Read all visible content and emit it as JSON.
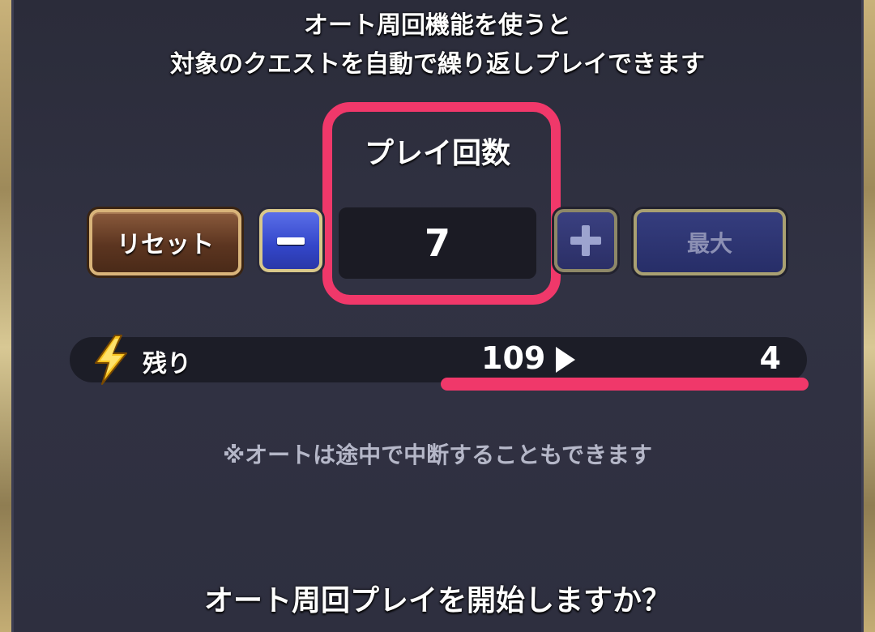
{
  "header": {
    "line1": "オート周回機能を使うと",
    "line2": "対象のクエストを自動で繰り返しプレイできます"
  },
  "play_count": {
    "label": "プレイ回数",
    "value": "7"
  },
  "buttons": {
    "reset": "リセット",
    "max": "最大",
    "minus_icon": "minus-icon",
    "plus_icon": "plus-icon"
  },
  "stamina": {
    "icon": "lightning-bolt-icon",
    "label": "残り",
    "current": "109",
    "after": "4"
  },
  "note": "※オートは途中で中断することもできます",
  "prompt": "オート周回プレイを開始しますか？",
  "colors": {
    "highlight": "#f0386a",
    "panel": "#2c2d3b"
  }
}
